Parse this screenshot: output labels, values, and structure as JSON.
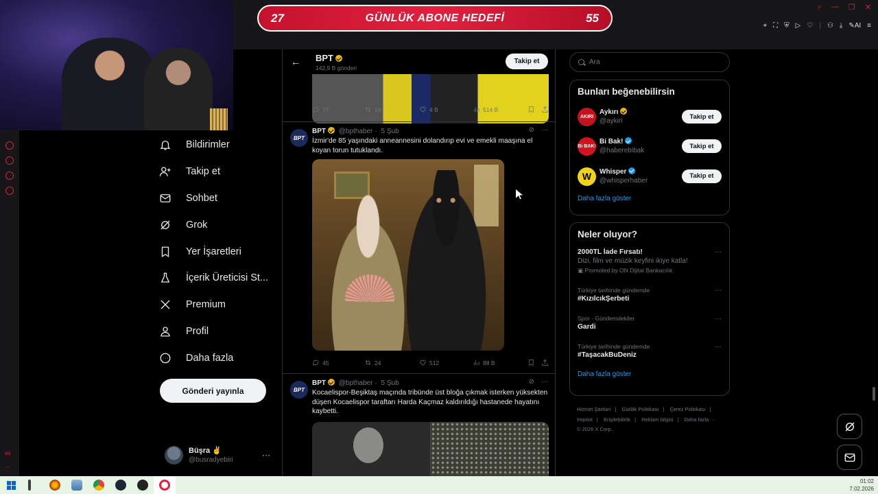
{
  "goal_banner": {
    "left": "27",
    "title": "GÜNLÜK ABONE HEDEFİ",
    "right": "55"
  },
  "left_strip": {
    "bottom_label": "ax",
    "more": "..."
  },
  "nav": {
    "items": [
      {
        "label": "Bildirimler",
        "icon": "bell-icon"
      },
      {
        "label": "Takip et",
        "icon": "add-user-icon"
      },
      {
        "label": "Sohbet",
        "icon": "mail-icon"
      },
      {
        "label": "Grok",
        "icon": "grok-icon"
      },
      {
        "label": "Yer İşaretleri",
        "icon": "bookmark-icon"
      },
      {
        "label": "İçerik Üreticisi St...",
        "icon": "creator-studio-icon"
      },
      {
        "label": "Premium",
        "icon": "x-logo-icon"
      },
      {
        "label": "Profil",
        "icon": "person-icon"
      },
      {
        "label": "Daha fazla",
        "icon": "more-circle-icon"
      }
    ],
    "post_button": "Gönderi yayınla",
    "user": {
      "name": "Büşra ✌️",
      "handle": "@busradyebiri",
      "menu": "···"
    }
  },
  "feed": {
    "header": {
      "name": "BPT",
      "sub": "142,9 B gönderi",
      "follow": "Takip et",
      "back": "←"
    },
    "first_actions": {
      "replies": "77",
      "reposts": "18",
      "likes": "4 B",
      "views": "514 B"
    },
    "tweets": [
      {
        "avatar": "BPT",
        "name": "BPT",
        "handle": "@bpthaber",
        "time": "5 Şub",
        "text": "İzmir'de 85 yaşındaki anneannesini dolandırıp evi ve emekli maaşına el koyan torun tutuklandı.",
        "actions": {
          "replies": "45",
          "reposts": "24",
          "likes": "512",
          "views": "88 B"
        }
      },
      {
        "avatar": "BPT",
        "name": "BPT",
        "handle": "@bpthaber",
        "time": "5 Şub",
        "text": "Kocaelispor-Beşiktaş maçında tribünde üst bloğa çıkmak isterken yüksekten düşen Kocaelispor taraftarı Harda Kaçmaz kaldırıldığı hastanede hayatını kaybetti."
      }
    ]
  },
  "sidebar": {
    "search_placeholder": "Ara",
    "who_to_follow": {
      "title": "Bunları beğenebilirsin",
      "items": [
        {
          "name": "Aykırı",
          "handle": "@aykiri",
          "button": "Takip et",
          "avatar_text": "AKIRI",
          "avatar_color": "#c4121f"
        },
        {
          "name": "Bi Bak!",
          "handle": "@haberebibak",
          "button": "Takip et",
          "avatar_text": "Bi BAK!",
          "avatar_color": "#d4121e"
        },
        {
          "name": "Whisper",
          "handle": "@whisperhaber",
          "button": "Takip et",
          "avatar_text": "W",
          "avatar_color": "#f2d31b"
        }
      ],
      "show_more": "Daha fazla göster"
    },
    "trends": {
      "title": "Neler oluyor?",
      "items": [
        {
          "name": "2000TL İade Fırsatı!",
          "desc": "Dizi, film ve müzik keyfini ikiye katla!",
          "promo": "Promoted by ON Dijital Bankacılık"
        },
        {
          "context": "Türkiye tarihinde gündemde",
          "name": "#KızılcıkŞerbeti"
        },
        {
          "context": "Spor · Gündemdekiler",
          "name": "Gardi"
        },
        {
          "context": "Türkiye tarihinde gündemde",
          "name": "#TaşacakBuDeniz"
        }
      ],
      "show_more": "Daha fazla göster"
    },
    "footer": [
      "Hizmet Şartları",
      "Gizlilik Politikası",
      "Çerez Politikası",
      "Imprint",
      "Erişilebilirlik",
      "Reklam bilgisi",
      "Daha fazla ···",
      "© 2026 X Corp."
    ]
  },
  "taskbar": {
    "time": "01:02",
    "date": "7.02.2026"
  }
}
